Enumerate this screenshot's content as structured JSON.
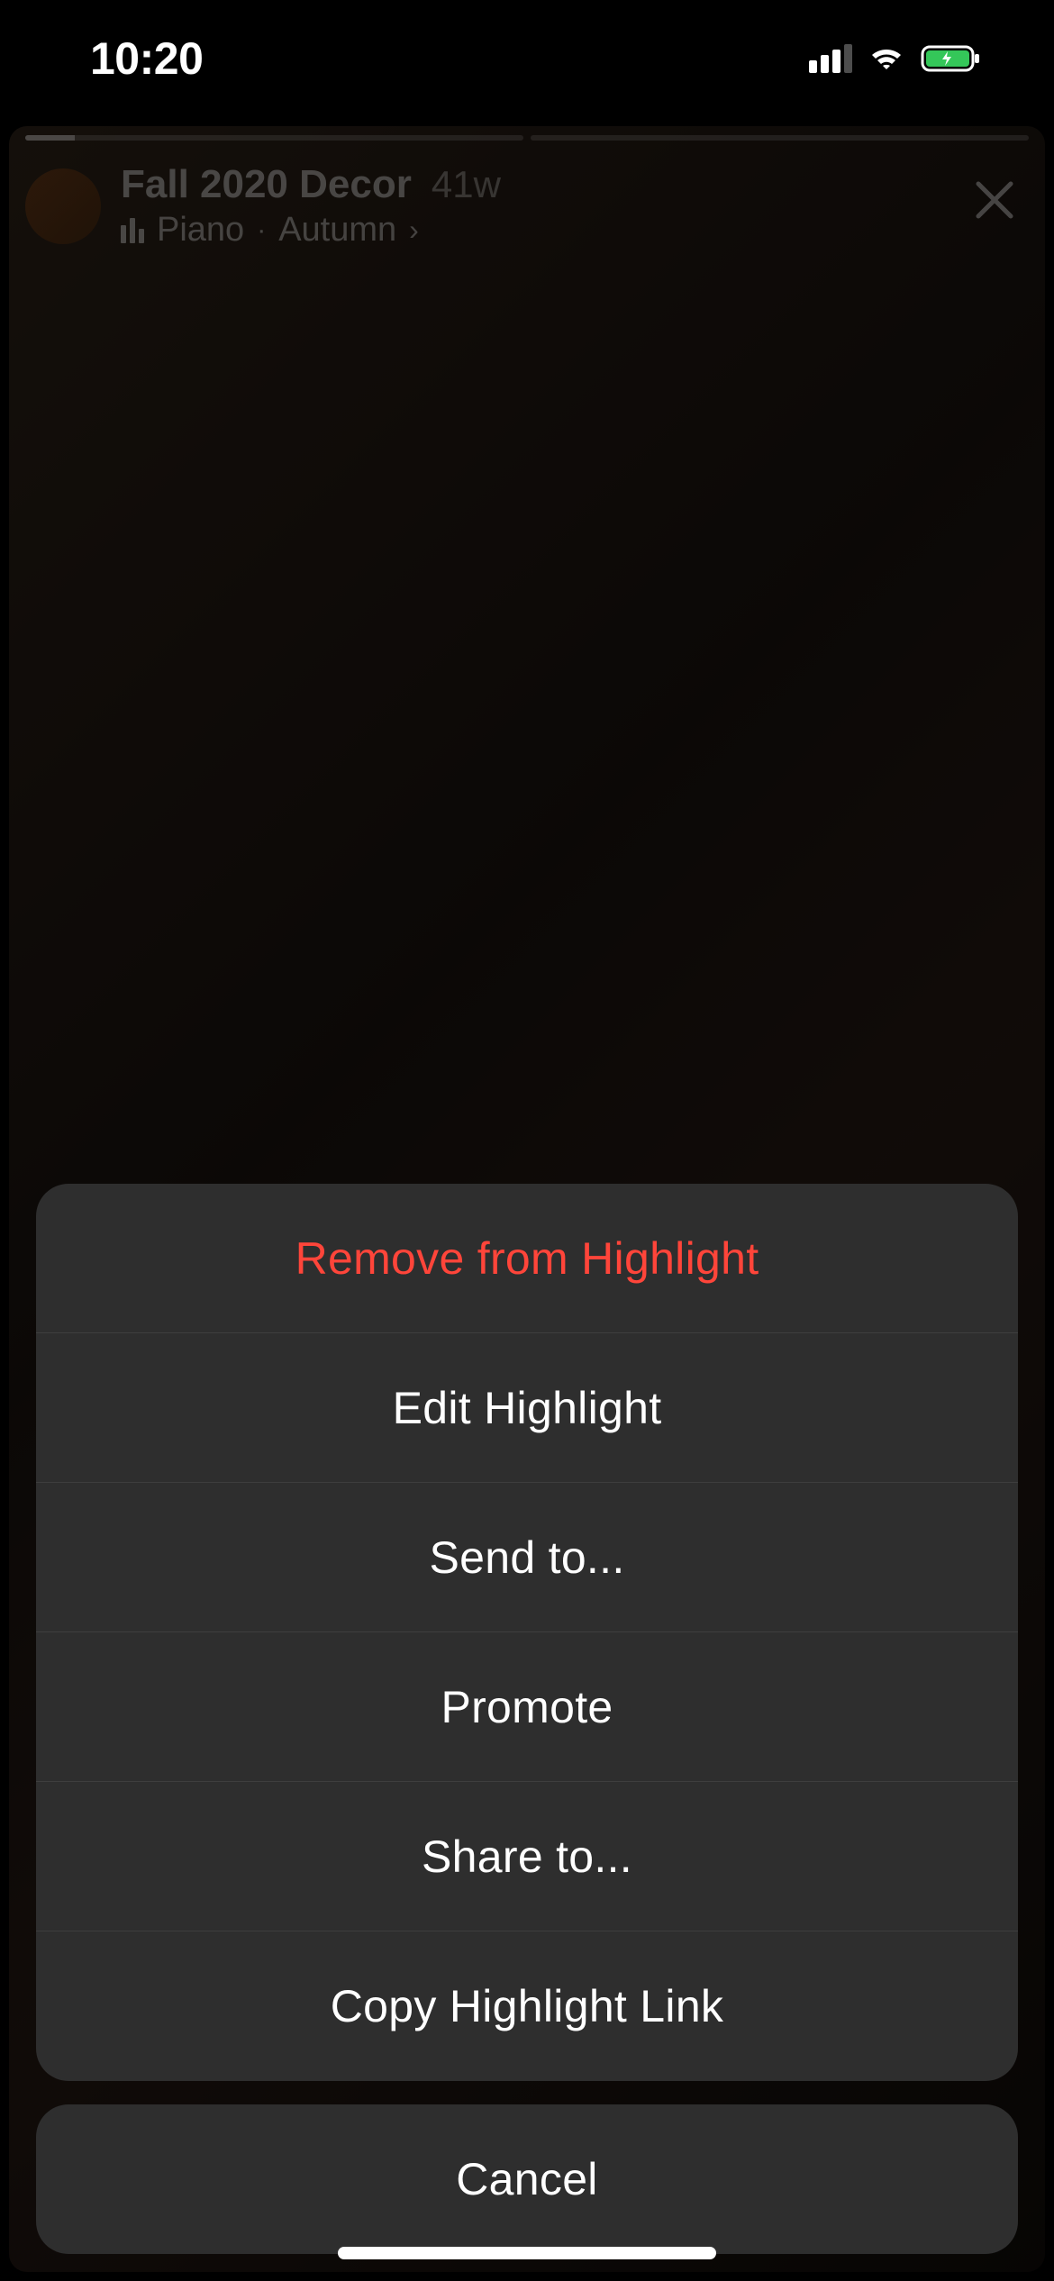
{
  "status": {
    "time": "10:20"
  },
  "story": {
    "title": "Fall 2020 Decor",
    "time_ago": "41w",
    "music_artist": "Piano",
    "music_track": "Autumn"
  },
  "action_sheet": {
    "items": [
      {
        "label": "Remove from Highlight",
        "destructive": true
      },
      {
        "label": "Edit Highlight",
        "destructive": false
      },
      {
        "label": "Send to...",
        "destructive": false
      },
      {
        "label": "Promote",
        "destructive": false
      },
      {
        "label": "Share to...",
        "destructive": false
      },
      {
        "label": "Copy Highlight Link",
        "destructive": false
      }
    ],
    "cancel_label": "Cancel"
  }
}
